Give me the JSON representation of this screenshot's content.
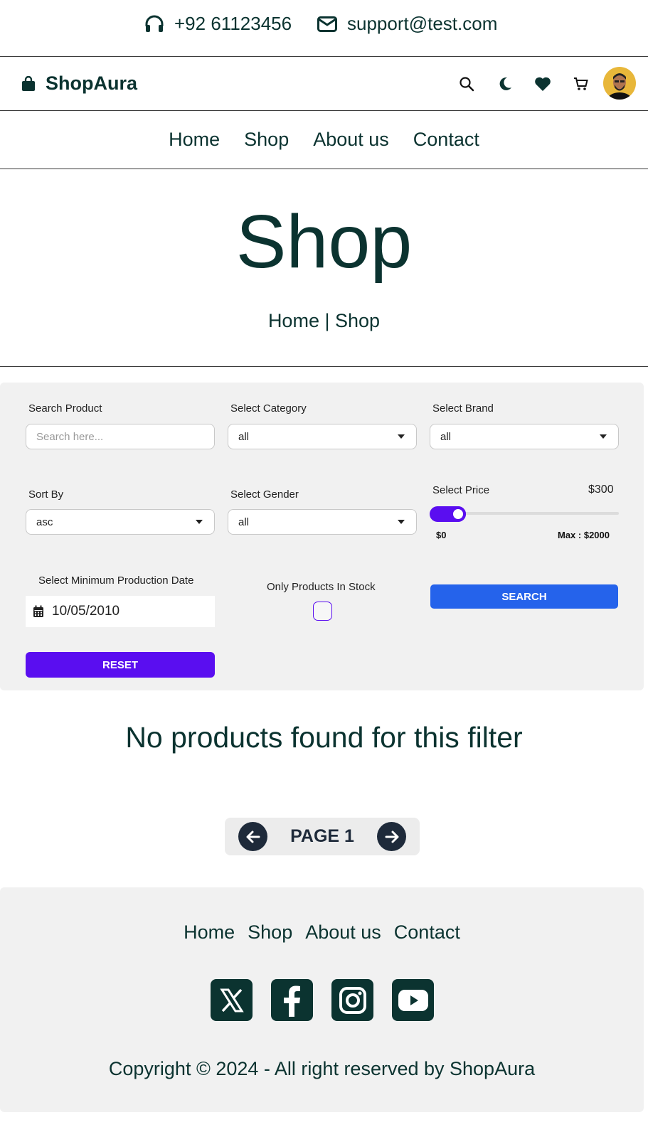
{
  "topbar": {
    "phone": "+92 61123456",
    "email": "support@test.com"
  },
  "header": {
    "brand": "ShopAura"
  },
  "nav": [
    "Home",
    "Shop",
    "About us",
    "Contact"
  ],
  "hero": {
    "title": "Shop",
    "breadcrumb": "Home | Shop"
  },
  "filters": {
    "search_label": "Search Product",
    "search_placeholder": "Search here...",
    "category_label": "Select Category",
    "category_value": "all",
    "brand_label": "Select Brand",
    "brand_value": "all",
    "sort_label": "Sort By",
    "sort_value": "asc",
    "gender_label": "Select Gender",
    "gender_value": "all",
    "price_label": "Select Price",
    "price_value": "$300",
    "price_min": "$0",
    "price_max": "Max : $2000",
    "price_fraction": 0.15,
    "date_label": "Select Minimum Production Date",
    "date_value": "10/05/2010",
    "stock_label": "Only Products In Stock",
    "search_button": "SEARCH",
    "reset_button": "RESET"
  },
  "results": {
    "empty_message": "No products found for this filter"
  },
  "pagination": {
    "label": "PAGE 1"
  },
  "footer": {
    "nav": [
      "Home",
      "Shop",
      "About us",
      "Contact"
    ],
    "social": [
      "x-icon",
      "facebook-icon",
      "instagram-icon",
      "youtube-icon"
    ],
    "copyright": "Copyright © 2024 - All right reserved by ShopAura"
  },
  "colors": {
    "primary_text": "#0b3330",
    "accent_purple": "#5a0ef0",
    "search_blue": "#2563eb"
  }
}
